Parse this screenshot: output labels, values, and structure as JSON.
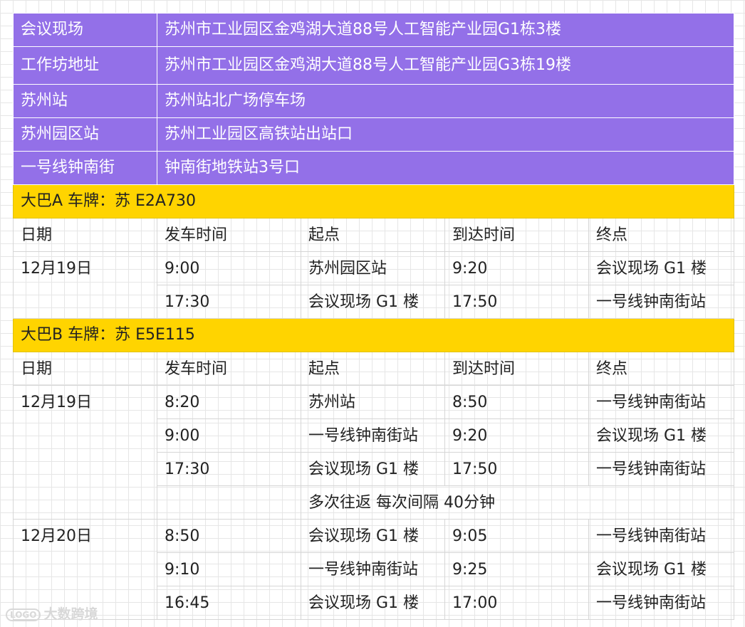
{
  "info": [
    {
      "label": "会议现场",
      "value": "苏州市工业园区金鸡湖大道88号人工智能产业园G1栋3楼"
    },
    {
      "label": "工作坊地址",
      "value": "苏州市工业园区金鸡湖大道88号人工智能产业园G3栋19楼"
    },
    {
      "label": "苏州站",
      "value": "苏州站北广场停车场"
    },
    {
      "label": "苏州园区站",
      "value": "苏州工业园区高铁站出站口"
    },
    {
      "label": "一号线钟南街",
      "value": "钟南街地铁站3号口"
    }
  ],
  "headers": [
    "日期",
    "发车时间",
    "起点",
    "到达时间",
    "终点"
  ],
  "busA": {
    "title": "大巴A  车牌：苏 E2A730",
    "date": "12月19日",
    "rows": [
      [
        "9:00",
        "苏州园区站",
        "9:20",
        "会议现场 G1 楼"
      ],
      [
        "17:30",
        "会议现场 G1 楼",
        "17:50",
        "一号线钟南街站"
      ]
    ]
  },
  "busB": {
    "title": "大巴B 车牌：苏 E5E115",
    "date1": "12月19日",
    "rows1": [
      [
        "8:20",
        "苏州站",
        "8:50",
        "一号线钟南街站"
      ],
      [
        "9:00",
        "一号线钟南街站",
        "9:20",
        "会议现场 G1 楼"
      ],
      [
        "17:30",
        "会议现场 G1 楼",
        "17:50",
        "一号线钟南街站"
      ]
    ],
    "note": "多次往返 每次间隔 40分钟",
    "date2": "12月20日",
    "rows2": [
      [
        "8:50",
        "会议现场 G1 楼",
        "9:05",
        "一号线钟南街站"
      ],
      [
        "9:10",
        "一号线钟南街站",
        "9:25",
        "会议现场 G1 楼"
      ],
      [
        "16:45",
        "会议现场 G1 楼",
        "17:00",
        "一号线钟南街站"
      ]
    ]
  },
  "watermark": {
    "logo": "LOGO",
    "text": "大数跨境"
  }
}
